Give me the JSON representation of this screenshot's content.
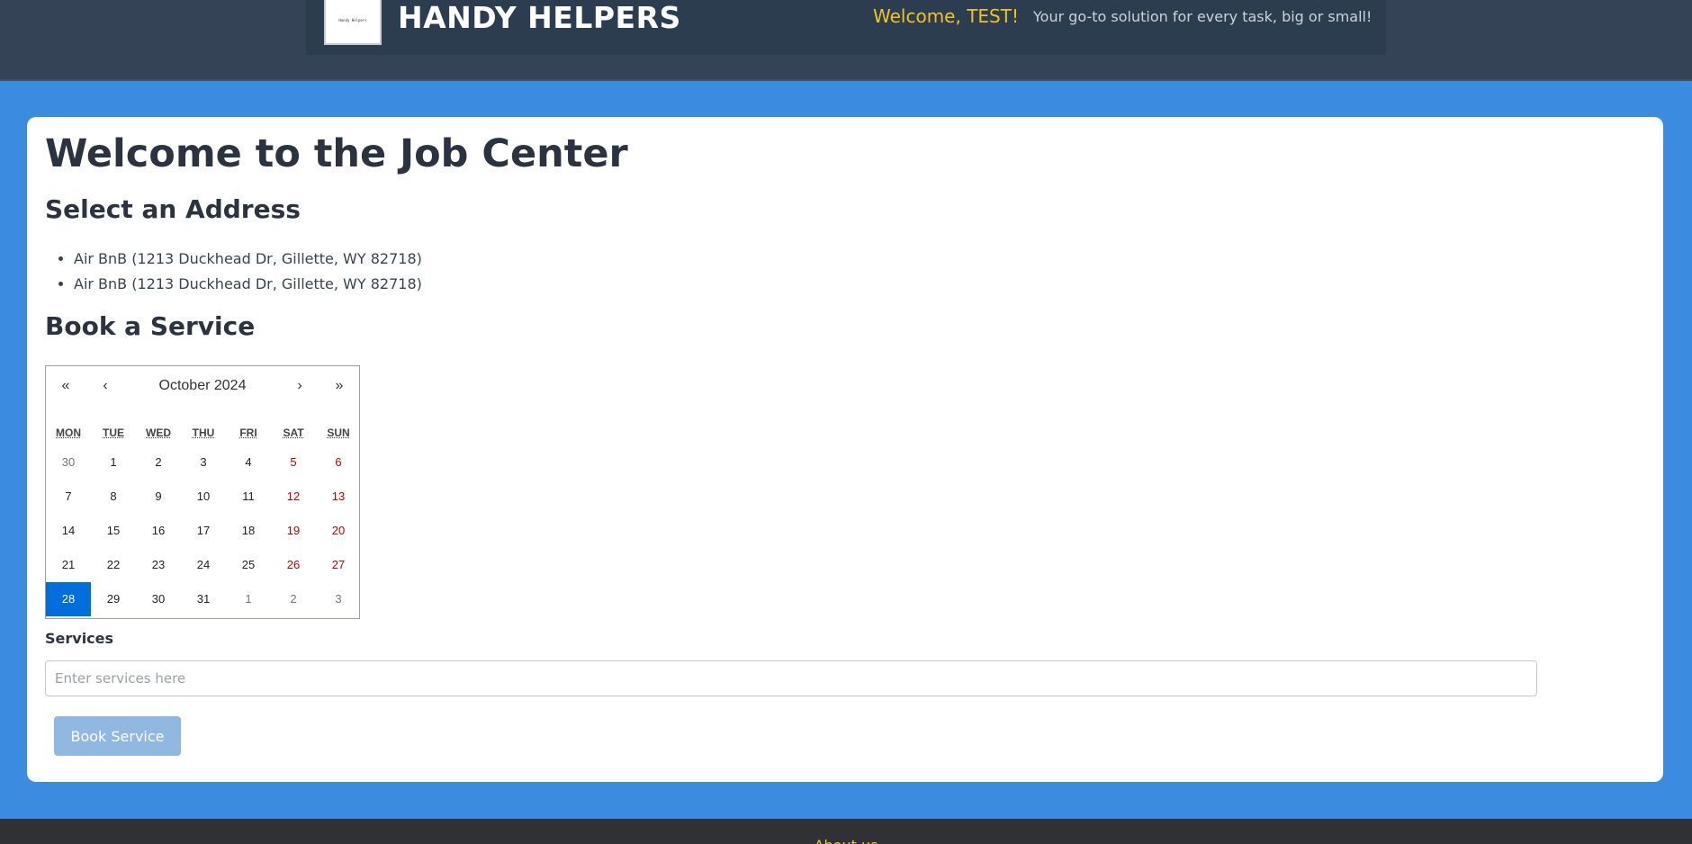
{
  "header": {
    "logo_text": "Handy Helpers",
    "brand": "HANDY HELPERS",
    "welcome": "Welcome, TEST!",
    "tagline": "Your go-to solution for every task, big or small!"
  },
  "main": {
    "title": "Welcome to the Job Center",
    "address_section_title": "Select an Address",
    "addresses": [
      "Air BnB (1213 Duckhead Dr, Gillette, WY 82718)",
      "Air BnB (1213 Duckhead Dr, Gillette, WY 82718)"
    ],
    "book_section_title": "Book a Service"
  },
  "calendar": {
    "nav_prev_year": "«",
    "nav_prev_month": "‹",
    "label": "October 2024",
    "nav_next_month": "›",
    "nav_next_year": "»",
    "weekdays": [
      "MON",
      "TUE",
      "WED",
      "THU",
      "FRI",
      "SAT",
      "SUN"
    ],
    "weeks": [
      [
        "30",
        "1",
        "2",
        "3",
        "4",
        "5",
        "6"
      ],
      [
        "7",
        "8",
        "9",
        "10",
        "11",
        "12",
        "13"
      ],
      [
        "14",
        "15",
        "16",
        "17",
        "18",
        "19",
        "20"
      ],
      [
        "21",
        "22",
        "23",
        "24",
        "25",
        "26",
        "27"
      ],
      [
        "28",
        "29",
        "30",
        "31",
        "1",
        "2",
        "3"
      ]
    ],
    "selected_day": "28"
  },
  "services": {
    "label": "Services",
    "placeholder": "Enter services here",
    "value": ""
  },
  "book_button_label": "Book Service",
  "footer": {
    "link": "About us"
  },
  "colors": {
    "page_bg": "#3b8be0",
    "header_bg": "#344356",
    "accent": "#f2c029",
    "selected_day": "#006edc",
    "weekend": "#c00000"
  }
}
